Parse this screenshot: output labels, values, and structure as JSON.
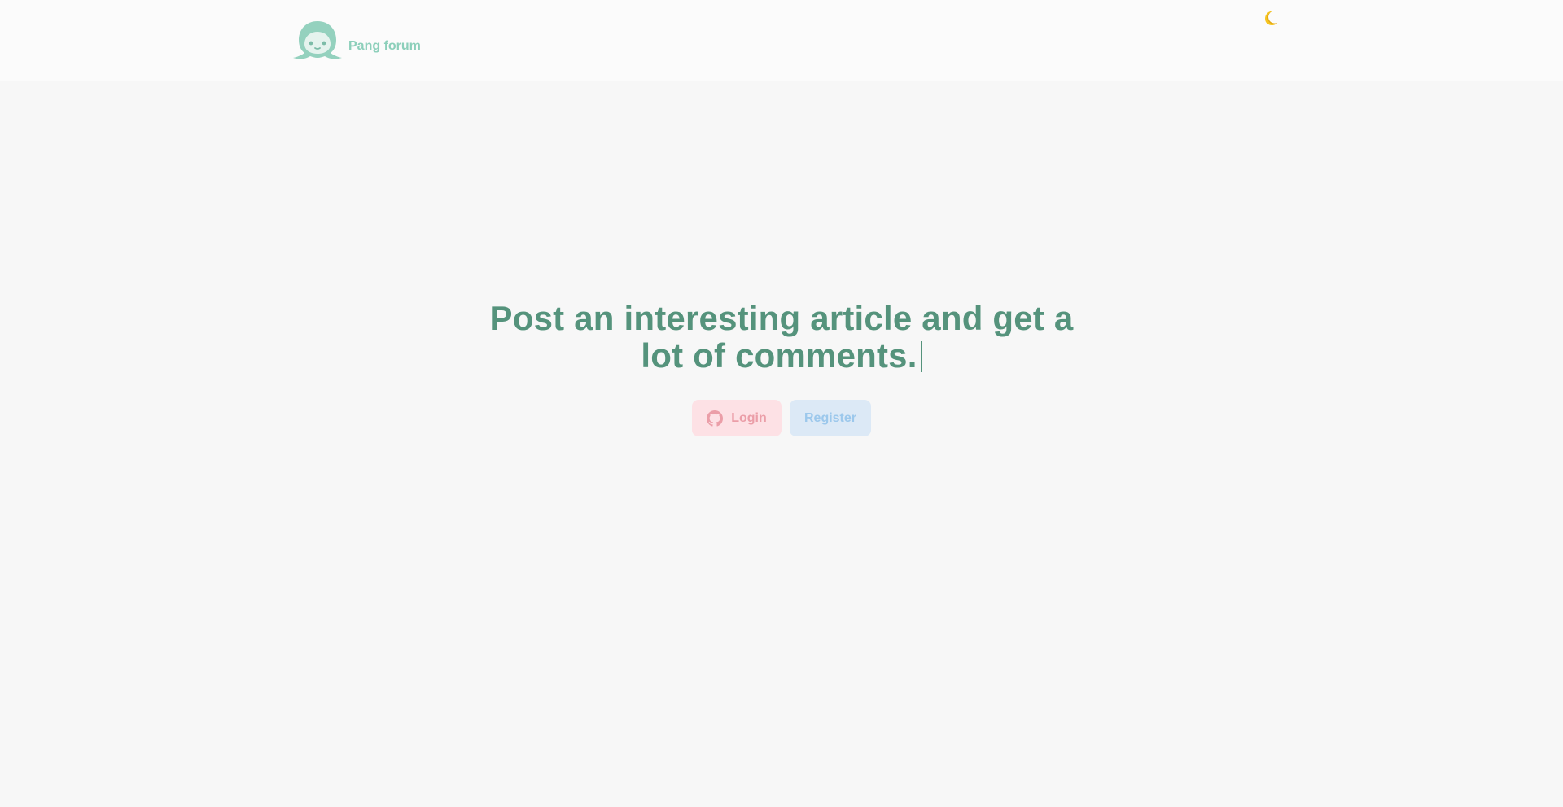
{
  "header": {
    "brand_name": "Pang forum",
    "logo_icon": "ghost-bubble-mascot-icon",
    "theme_toggle_icon": "moon-icon"
  },
  "hero": {
    "headline": "Post an interesting article and get a lot of comments.",
    "login_label": "Login",
    "login_icon": "github-icon",
    "register_label": "Register"
  },
  "colors": {
    "brand": "#8ccfba",
    "headline": "#55937c",
    "login_bg": "#fde1e5",
    "login_text": "#eb9ea8",
    "register_bg": "#dce9f6",
    "register_text": "#9cc8ec",
    "moon": "#f6c521"
  }
}
